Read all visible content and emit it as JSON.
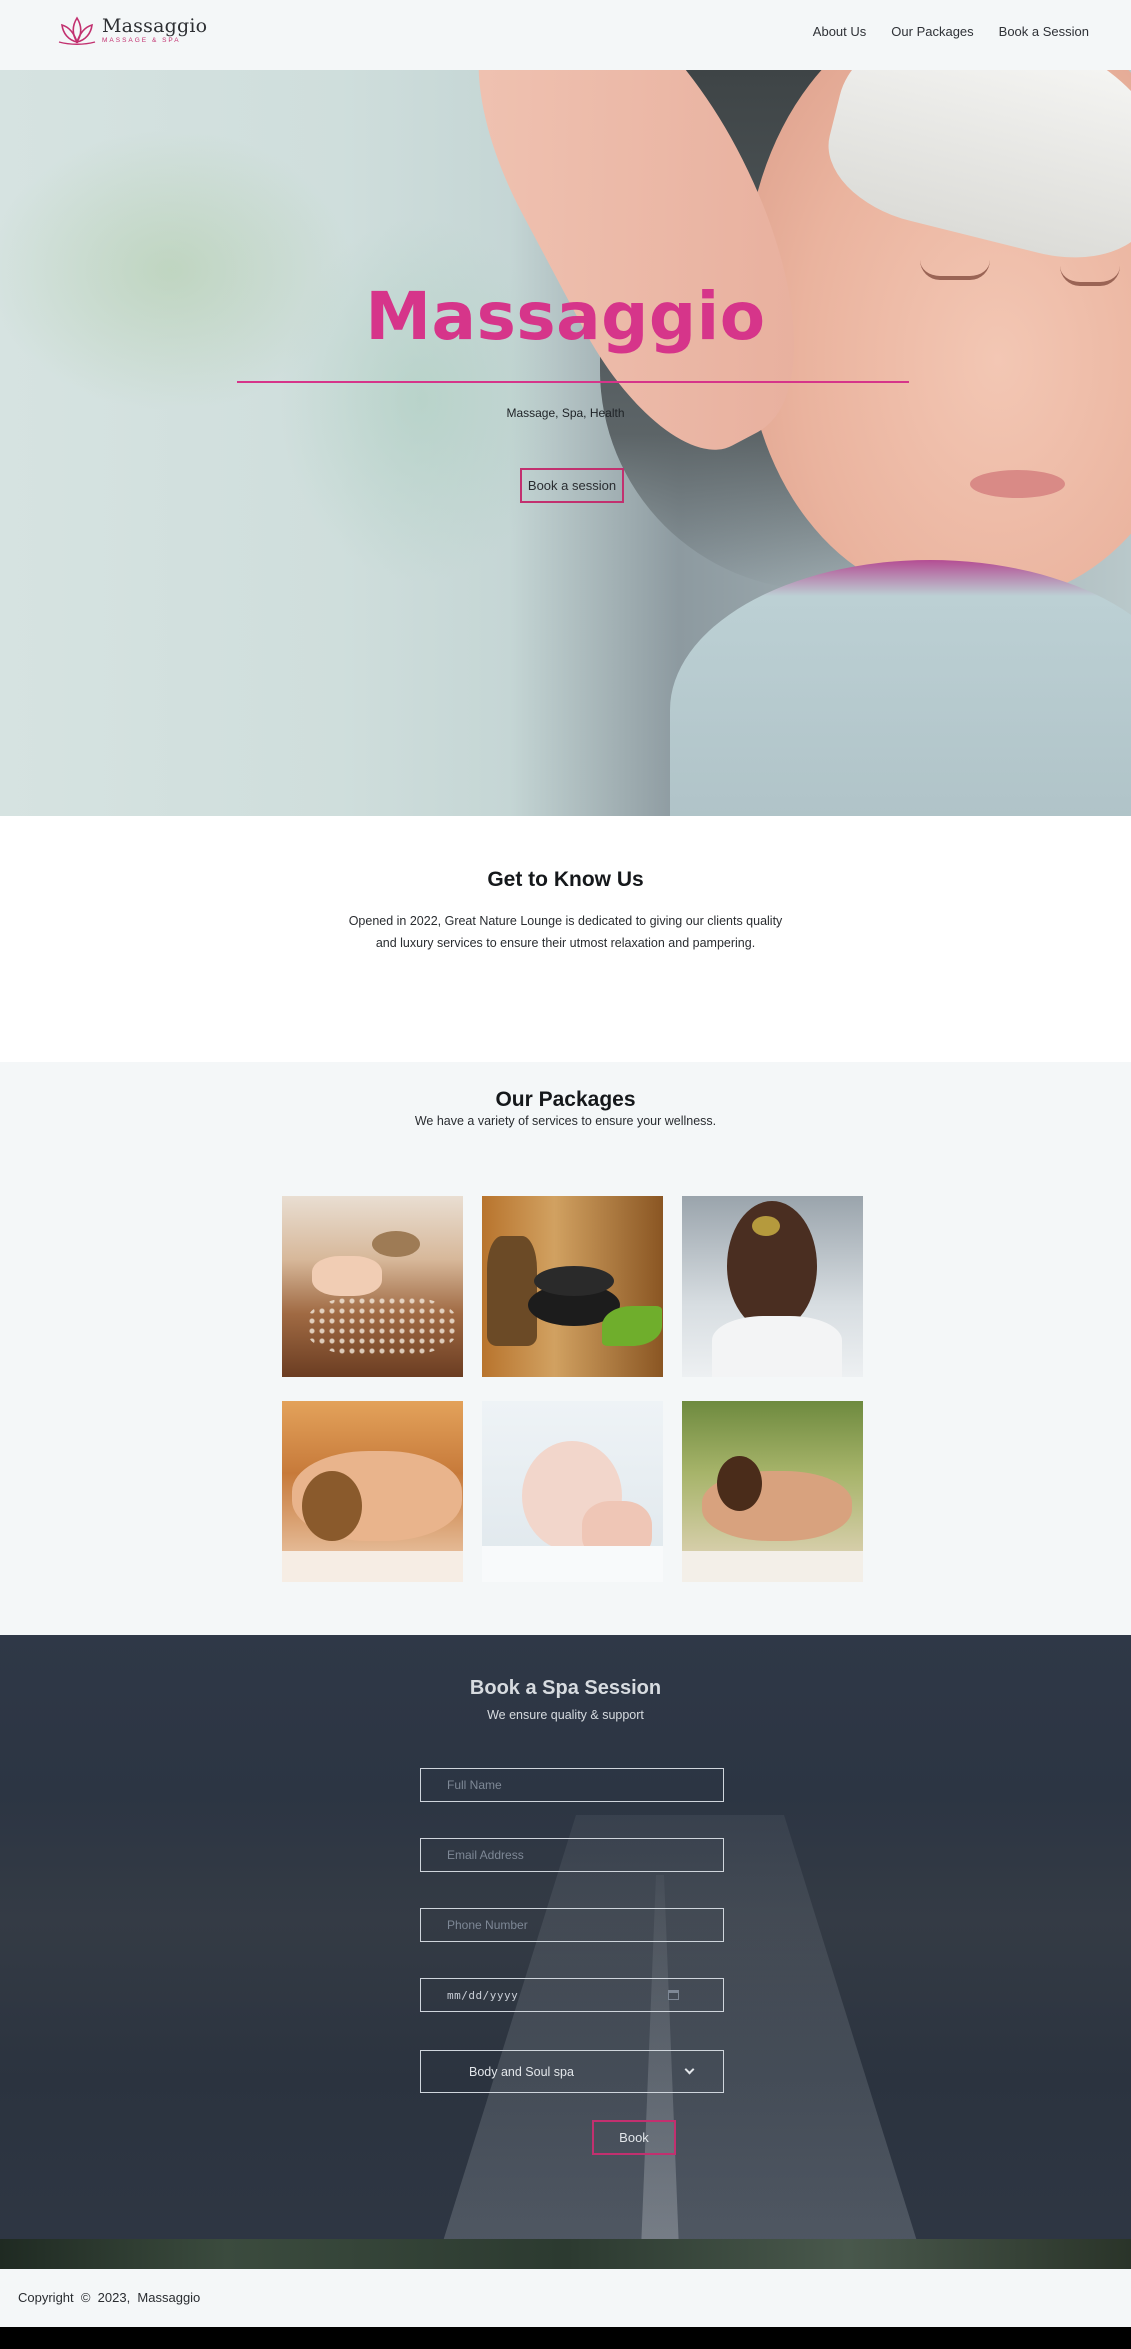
{
  "brand": {
    "name": "Massaggio",
    "tagline": "MASSAGE & SPA",
    "accent_color": "#d6358a",
    "border_color": "#c2306f"
  },
  "nav": {
    "items": [
      {
        "label": "About Us"
      },
      {
        "label": "Our Packages"
      },
      {
        "label": "Book a Session"
      }
    ]
  },
  "hero": {
    "title": "Massaggio",
    "subtitle": "Massage, Spa, Health",
    "button_label": "Book a session"
  },
  "about": {
    "title": "Get to Know Us",
    "text": "Opened in 2022, Great Nature Lounge is dedicated to giving our clients quality and luxury services to ensure their utmost relaxation and pampering."
  },
  "packages": {
    "title": "Our Packages",
    "subtitle": "We have a variety of services to ensure your wellness.",
    "items": [
      {
        "icon": "body-scrub-image"
      },
      {
        "icon": "hot-stones-image"
      },
      {
        "icon": "facial-treatment-image"
      },
      {
        "icon": "back-massage-image"
      },
      {
        "icon": "face-massage-image"
      },
      {
        "icon": "stone-massage-image"
      }
    ]
  },
  "booking": {
    "title": "Book a Spa Session",
    "subtitle": "We ensure quality & support",
    "fields": {
      "full_name_placeholder": "Full Name",
      "email_placeholder": "Email Address",
      "phone_placeholder": "Phone Number",
      "date_placeholder": "mm/dd/yyyy",
      "package_selected": "Body and Soul spa"
    },
    "button_label": "Book"
  },
  "footer": {
    "copyright": "Copyright  ©  2023,  Massaggio"
  }
}
